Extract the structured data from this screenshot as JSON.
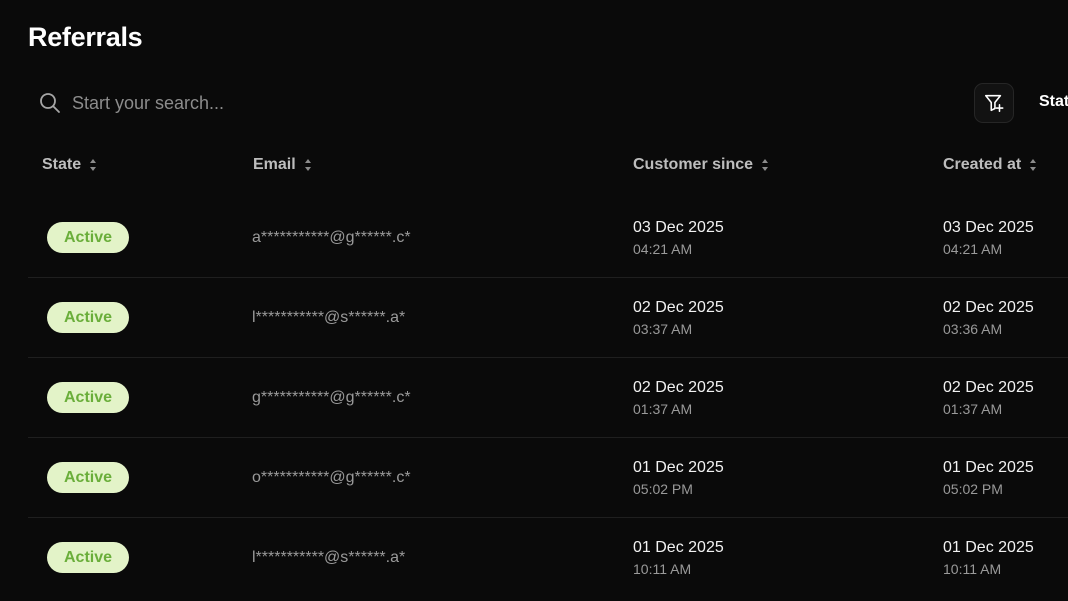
{
  "page": {
    "title": "Referrals"
  },
  "search": {
    "placeholder": "Start your search..."
  },
  "toolbar": {
    "filter_icon": "filter-plus-icon",
    "status_label": "Status"
  },
  "table": {
    "columns": [
      {
        "label": "State"
      },
      {
        "label": "Email"
      },
      {
        "label": "Customer since"
      },
      {
        "label": "Created at"
      }
    ],
    "rows": [
      {
        "state": "Active",
        "email": "a***********@g******.c*",
        "customer_since_date": "03 Dec 2025",
        "customer_since_time": "04:21 AM",
        "created_date": "03 Dec 2025",
        "created_time": "04:21 AM"
      },
      {
        "state": "Active",
        "email": "l***********@s******.a*",
        "customer_since_date": "02 Dec 2025",
        "customer_since_time": "03:37 AM",
        "created_date": "02 Dec 2025",
        "created_time": "03:36 AM"
      },
      {
        "state": "Active",
        "email": "g***********@g******.c*",
        "customer_since_date": "02 Dec 2025",
        "customer_since_time": "01:37 AM",
        "created_date": "02 Dec 2025",
        "created_time": "01:37 AM"
      },
      {
        "state": "Active",
        "email": "o***********@g******.c*",
        "customer_since_date": "01 Dec 2025",
        "customer_since_time": "05:02 PM",
        "created_date": "01 Dec 2025",
        "created_time": "05:02 PM"
      },
      {
        "state": "Active",
        "email": "l***********@s******.a*",
        "customer_since_date": "01 Dec 2025",
        "customer_since_time": "10:11 AM",
        "created_date": "01 Dec 2025",
        "created_time": "10:11 AM"
      }
    ]
  },
  "colors": {
    "background": "#0a0a0a",
    "badge_bg": "#e3f3c8",
    "badge_text": "#6aae3a"
  }
}
